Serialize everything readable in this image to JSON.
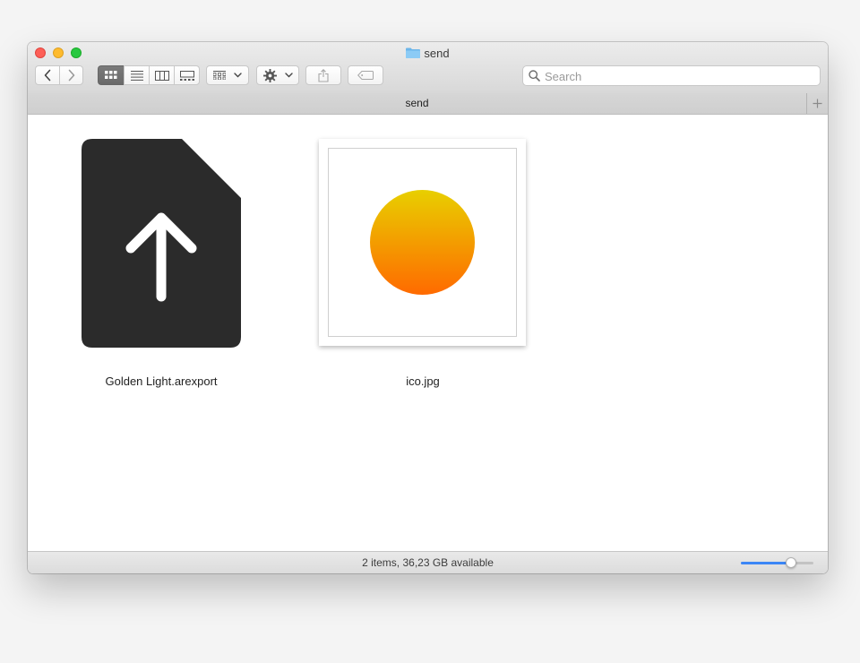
{
  "window": {
    "title": "send",
    "title_icon": "folder-icon"
  },
  "toolbar": {
    "back_icon": "chevron-left-icon",
    "forward_icon": "chevron-right-icon",
    "view_modes": [
      "icon-view",
      "list-view",
      "column-view",
      "gallery-view"
    ],
    "active_view": "icon-view",
    "group_icon": "group-by-icon",
    "action_icon": "gear-icon",
    "share_icon": "share-icon",
    "tag_icon": "tag-icon",
    "search_placeholder": "Search"
  },
  "tabbar": {
    "tab_label": "send",
    "add_icon": "plus-icon"
  },
  "files": [
    {
      "name": "Golden Light.arexport",
      "icon": "file-upload-icon"
    },
    {
      "name": "ico.jpg",
      "icon": "image-thumbnail"
    }
  ],
  "statusbar": {
    "text": "2 items, 36,23 GB available",
    "zoom_fraction": 0.69
  },
  "colors": {
    "accent": "#3b86f6",
    "file_icon": "#2b2b2b",
    "sun_top": "#e8cf00",
    "sun_bottom": "#ff6a00"
  }
}
